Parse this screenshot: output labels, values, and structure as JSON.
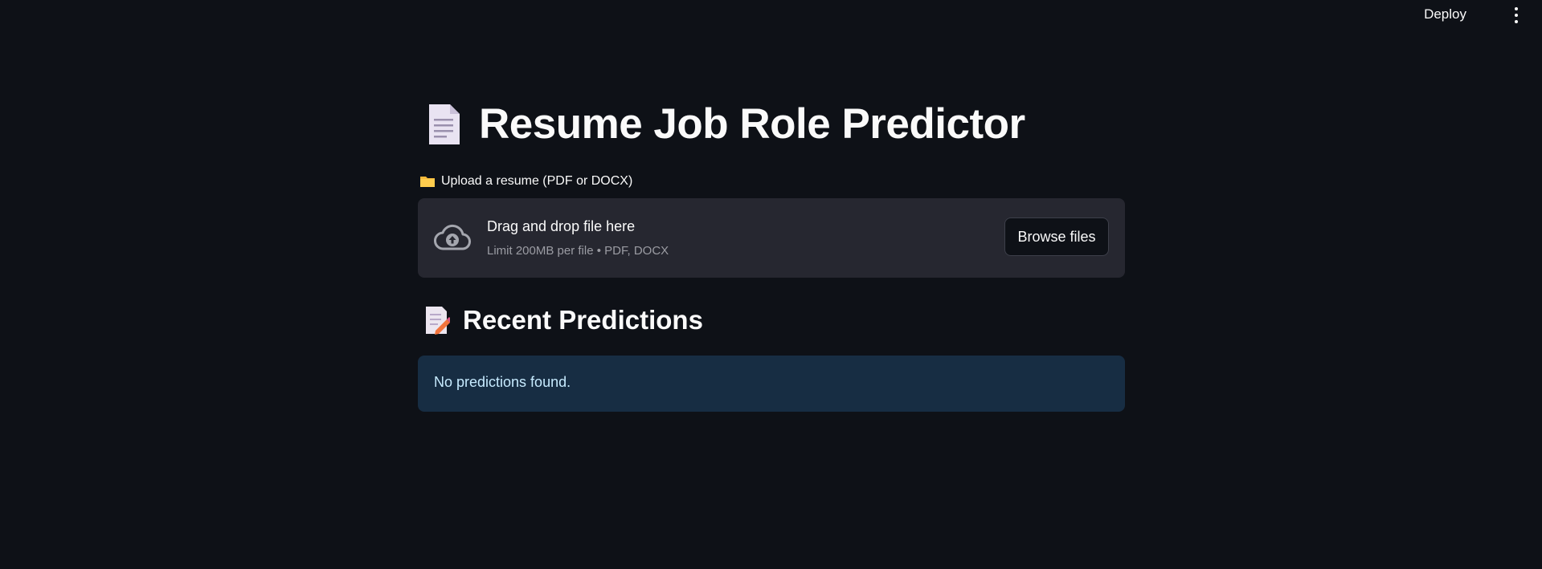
{
  "header": {
    "deploy_label": "Deploy",
    "menu_icon": "kebab-menu-icon"
  },
  "page": {
    "title": "Resume Job Role Predictor",
    "title_icon": "page-document-icon"
  },
  "uploader": {
    "label": "Upload a resume (PDF or DOCX)",
    "label_icon": "folder-icon",
    "drop_title": "Drag and drop file here",
    "drop_subtitle": "Limit 200MB per file • PDF, DOCX",
    "browse_label": "Browse files",
    "drop_icon": "cloud-upload-icon"
  },
  "recent": {
    "heading": "Recent Predictions",
    "heading_icon": "memo-icon",
    "empty_message": "No predictions found."
  },
  "colors": {
    "background": "#0e1117",
    "dropzone_bg": "#262730",
    "info_bg": "#172d43",
    "info_text": "#c7ebff"
  }
}
